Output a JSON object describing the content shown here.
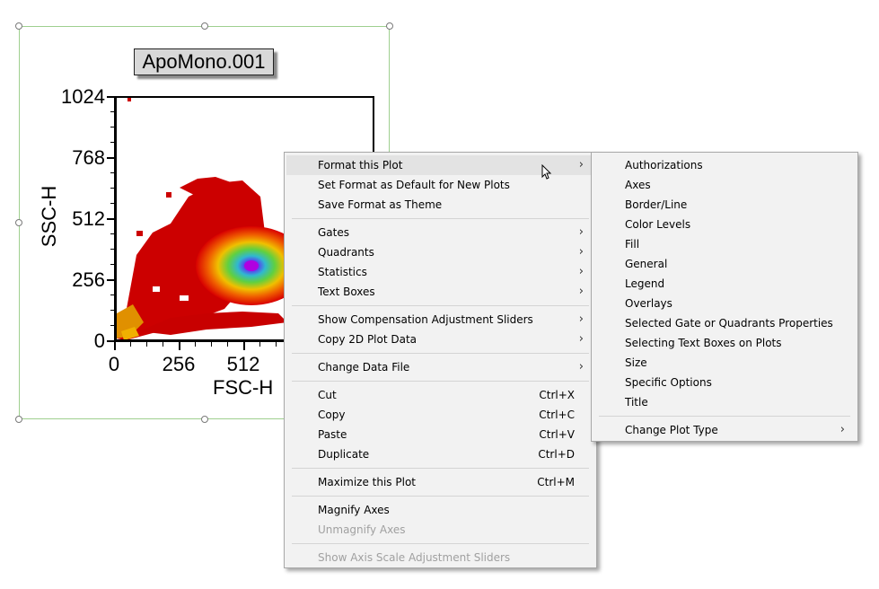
{
  "plot": {
    "title": "ApoMono.001",
    "x_label": "FSC-H",
    "y_label": "SSC-H",
    "y_ticks": [
      "1024",
      "768",
      "512",
      "256",
      "0"
    ],
    "x_ticks": [
      "0",
      "256",
      "512"
    ]
  },
  "context_menu": {
    "items": [
      {
        "label": "Format this Plot",
        "shortcut": "",
        "submenu": true
      },
      {
        "label": "Set Format as Default for New Plots",
        "shortcut": "",
        "submenu": false
      },
      {
        "label": "Save Format as Theme",
        "shortcut": "",
        "submenu": false
      },
      {
        "label": "Gates",
        "shortcut": "",
        "submenu": true
      },
      {
        "label": "Quadrants",
        "shortcut": "",
        "submenu": true
      },
      {
        "label": "Statistics",
        "shortcut": "",
        "submenu": true
      },
      {
        "label": "Text Boxes",
        "shortcut": "",
        "submenu": true
      },
      {
        "label": "Show Compensation Adjustment Sliders",
        "shortcut": "",
        "submenu": true
      },
      {
        "label": "Copy 2D Plot Data",
        "shortcut": "",
        "submenu": true
      },
      {
        "label": "Change Data File",
        "shortcut": "",
        "submenu": true
      },
      {
        "label": "Cut",
        "shortcut": "Ctrl+X",
        "submenu": false
      },
      {
        "label": "Copy",
        "shortcut": "Ctrl+C",
        "submenu": false
      },
      {
        "label": "Paste",
        "shortcut": "Ctrl+V",
        "submenu": false
      },
      {
        "label": "Duplicate",
        "shortcut": "Ctrl+D",
        "submenu": false
      },
      {
        "label": "Maximize this Plot",
        "shortcut": "Ctrl+M",
        "submenu": false
      },
      {
        "label": "Magnify Axes",
        "shortcut": "",
        "submenu": false
      },
      {
        "label": "Unmagnify Axes",
        "shortcut": "",
        "submenu": false,
        "disabled": true
      },
      {
        "label": "Show Axis Scale Adjustment Sliders",
        "shortcut": "",
        "submenu": false,
        "disabled": true
      }
    ]
  },
  "format_submenu": {
    "items": [
      "Authorizations",
      "Axes",
      "Border/Line",
      "Color Levels",
      "Fill",
      "General",
      "Legend",
      "Overlays",
      "Selected Gate or Quadrants Properties",
      "Selecting Text Boxes on Plots",
      "Size",
      "Specific Options",
      "Title",
      "Change Plot Type"
    ]
  },
  "arrow_glyph": "›",
  "colors": {
    "density_low": "#cc0000",
    "density_mid": "#f5a000",
    "density_high": "#40c040",
    "density_peak": "#b000e0"
  }
}
